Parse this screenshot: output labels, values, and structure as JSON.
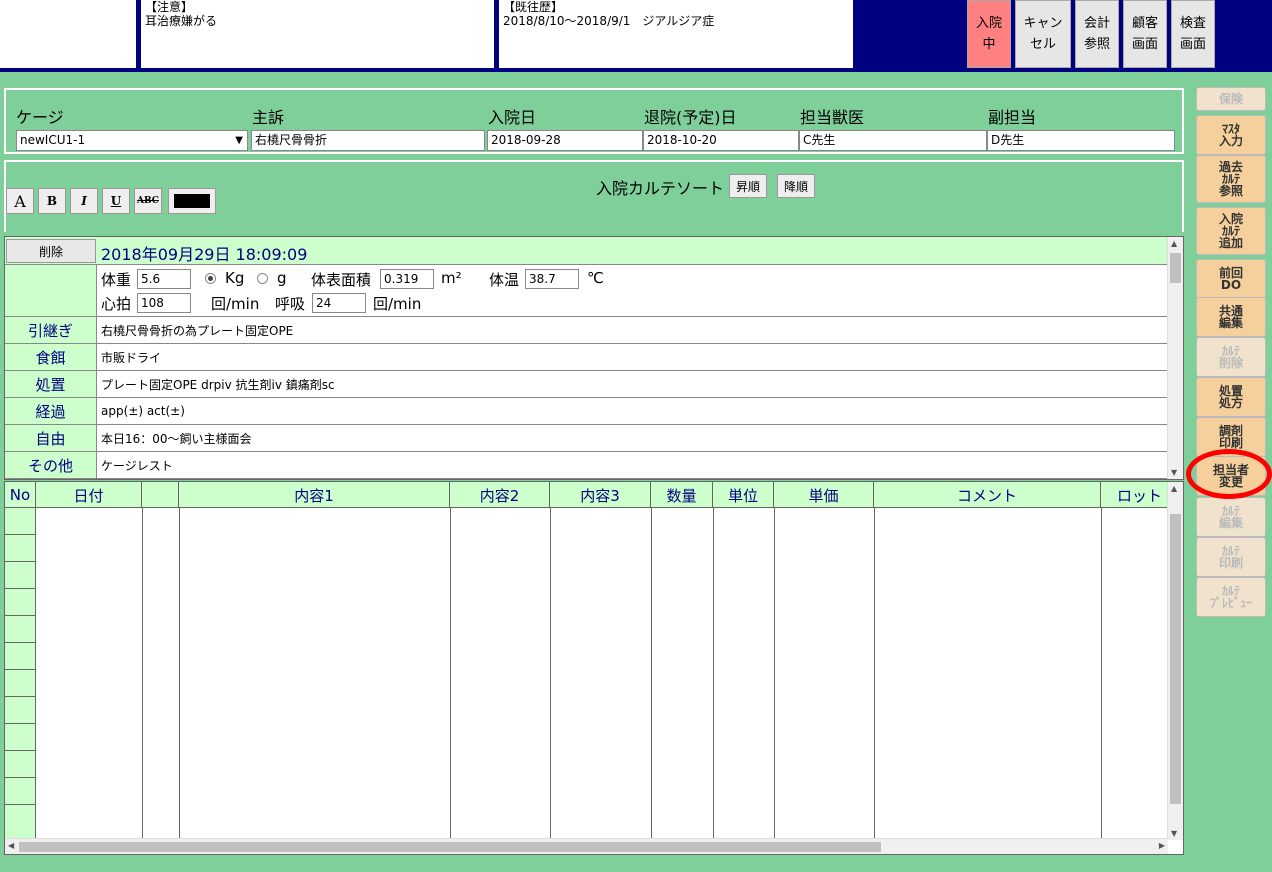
{
  "header": {
    "caution_title": "【注意】",
    "caution_text": "耳治療嫌がる",
    "history_title": "【既往歴】",
    "history_text": "2018/8/10～2018/9/1　ジアルジア症",
    "buttons": {
      "nyuin": "入院\n中",
      "cancel": "キャン\nセル",
      "kaikei": "会計\n参照",
      "kokyaku": "顧客\n画面",
      "kensa": "検査\n画面"
    }
  },
  "info": {
    "labels": {
      "cage": "ケージ",
      "complaint": "主訴",
      "admit": "入院日",
      "discharge": "退院(予定)日",
      "vet": "担当獣医",
      "sub": "副担当"
    },
    "values": {
      "cage": "newICU1-1",
      "complaint": "右橈尺骨骨折",
      "admit": "2018-09-28",
      "discharge": "2018-10-20",
      "vet": "C先生",
      "sub": "D先生"
    }
  },
  "toolbar": {
    "font_btn": "A",
    "bold_btn": "B",
    "italic_btn": "I",
    "underline_btn": "U",
    "strike_btn": "ABC",
    "sort_label": "入院カルテソート",
    "asc": "昇順",
    "desc": "降順"
  },
  "record": {
    "delete": "削除",
    "datetime": "2018年09月29日 18:09:09",
    "vitals": {
      "weight_label": "体重",
      "weight": "5.6",
      "kg": "Kg",
      "g": "g",
      "bsa_label": "体表面積",
      "bsa": "0.319",
      "bsa_unit": "m²",
      "temp_label": "体温",
      "temp": "38.7",
      "temp_unit": "℃",
      "hr_label": "心拍",
      "hr": "108",
      "hr_unit": "回/min",
      "rr_label": "呼吸",
      "rr": "24",
      "rr_unit": "回/min"
    },
    "rows": [
      {
        "label": "引継ぎ",
        "value": "右橈尺骨骨折の為プレート固定OPE"
      },
      {
        "label": "食餌",
        "value": "市販ドライ"
      },
      {
        "label": "処置",
        "value": "プレート固定OPE drpiv 抗生剤iv 鎮痛剤sc"
      },
      {
        "label": "経過",
        "value": "app(±) act(±)"
      },
      {
        "label": "自由",
        "value": "本日16：00～飼い主様面会"
      },
      {
        "label": "その他",
        "value": "ケージレスト"
      }
    ]
  },
  "detail": {
    "columns": [
      "No",
      "日付",
      "",
      "内容1",
      "内容2",
      "内容3",
      "数量",
      "単位",
      "単価",
      "コメント",
      "ロット"
    ]
  },
  "side_buttons": [
    {
      "id": "hoken",
      "label": "保険",
      "disabled": true
    },
    {
      "id": "master",
      "label": "ﾏｽﾀ\n入力",
      "disabled": false
    },
    {
      "id": "past",
      "label": "過去\nｶﾙﾃ\n参照",
      "disabled": false
    },
    {
      "id": "add",
      "label": "入院\nｶﾙﾃ\n追加",
      "disabled": false
    },
    {
      "id": "prev",
      "label": "前回\nDO",
      "disabled": false
    },
    {
      "id": "common",
      "label": "共通\n編集",
      "disabled": false
    },
    {
      "id": "del",
      "label": "ｶﾙﾃ\n削除",
      "disabled": true
    },
    {
      "id": "treat",
      "label": "処置\n処方",
      "disabled": false
    },
    {
      "id": "prep",
      "label": "調剤\n印刷",
      "disabled": false
    },
    {
      "id": "change",
      "label": "担当者\n変更",
      "disabled": false
    },
    {
      "id": "edit",
      "label": "ｶﾙﾃ\n編集",
      "disabled": true
    },
    {
      "id": "print",
      "label": "ｶﾙﾃ\n印刷",
      "disabled": true
    },
    {
      "id": "preview",
      "label": "ｶﾙﾃ\nﾌﾟﾚﾋﾞｭｰ",
      "disabled": true
    }
  ]
}
